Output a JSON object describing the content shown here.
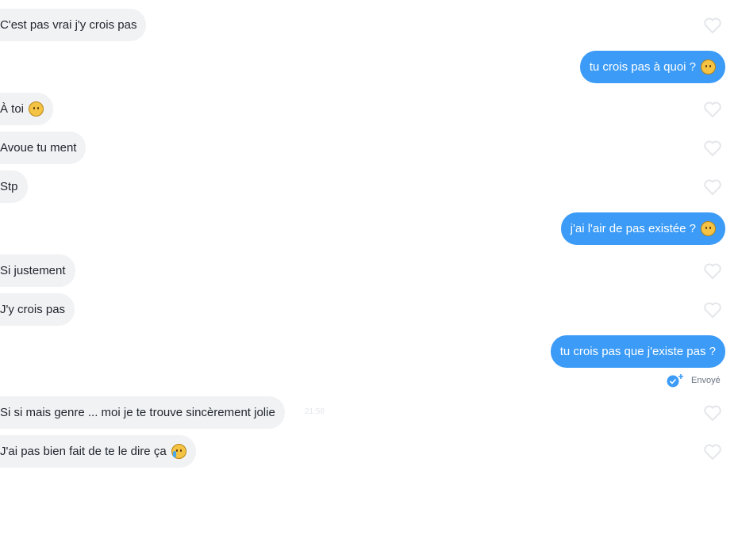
{
  "messages": [
    {
      "side": "in",
      "text": "C'est pas vrai j'y crois pas"
    },
    {
      "side": "out",
      "text": "tu crois pas à quoi ?",
      "emoji": "grinning-sweat-emoji"
    },
    {
      "side": "in",
      "text": "À toi",
      "emoji": "slightly-smiling-face-emoji"
    },
    {
      "side": "in",
      "text": "Avoue tu ment"
    },
    {
      "side": "in",
      "text": "Stp"
    },
    {
      "side": "out",
      "text": "j'ai l'air de pas existée ?",
      "emoji": "thinking-face-emoji"
    },
    {
      "side": "in",
      "text": "Si justement"
    },
    {
      "side": "in",
      "text": "J'y crois pas"
    },
    {
      "side": "out",
      "text": "tu crois pas que j'existe pas ?"
    },
    {
      "side": "in",
      "text": "Si si mais genre ... moi je te trouve sincèrement jolie",
      "time": "21:58"
    },
    {
      "side": "in",
      "text": "J'ai pas bien fait de te le dire ça",
      "emoji": "crying-face-emoji"
    }
  ],
  "status": {
    "sent_label": "Envoyé",
    "icon": "double-check-icon"
  },
  "colors": {
    "outgoing_bubble": "#3b9bf7",
    "incoming_bubble": "#f1f2f4",
    "heart_outline": "#e4e6ea"
  }
}
